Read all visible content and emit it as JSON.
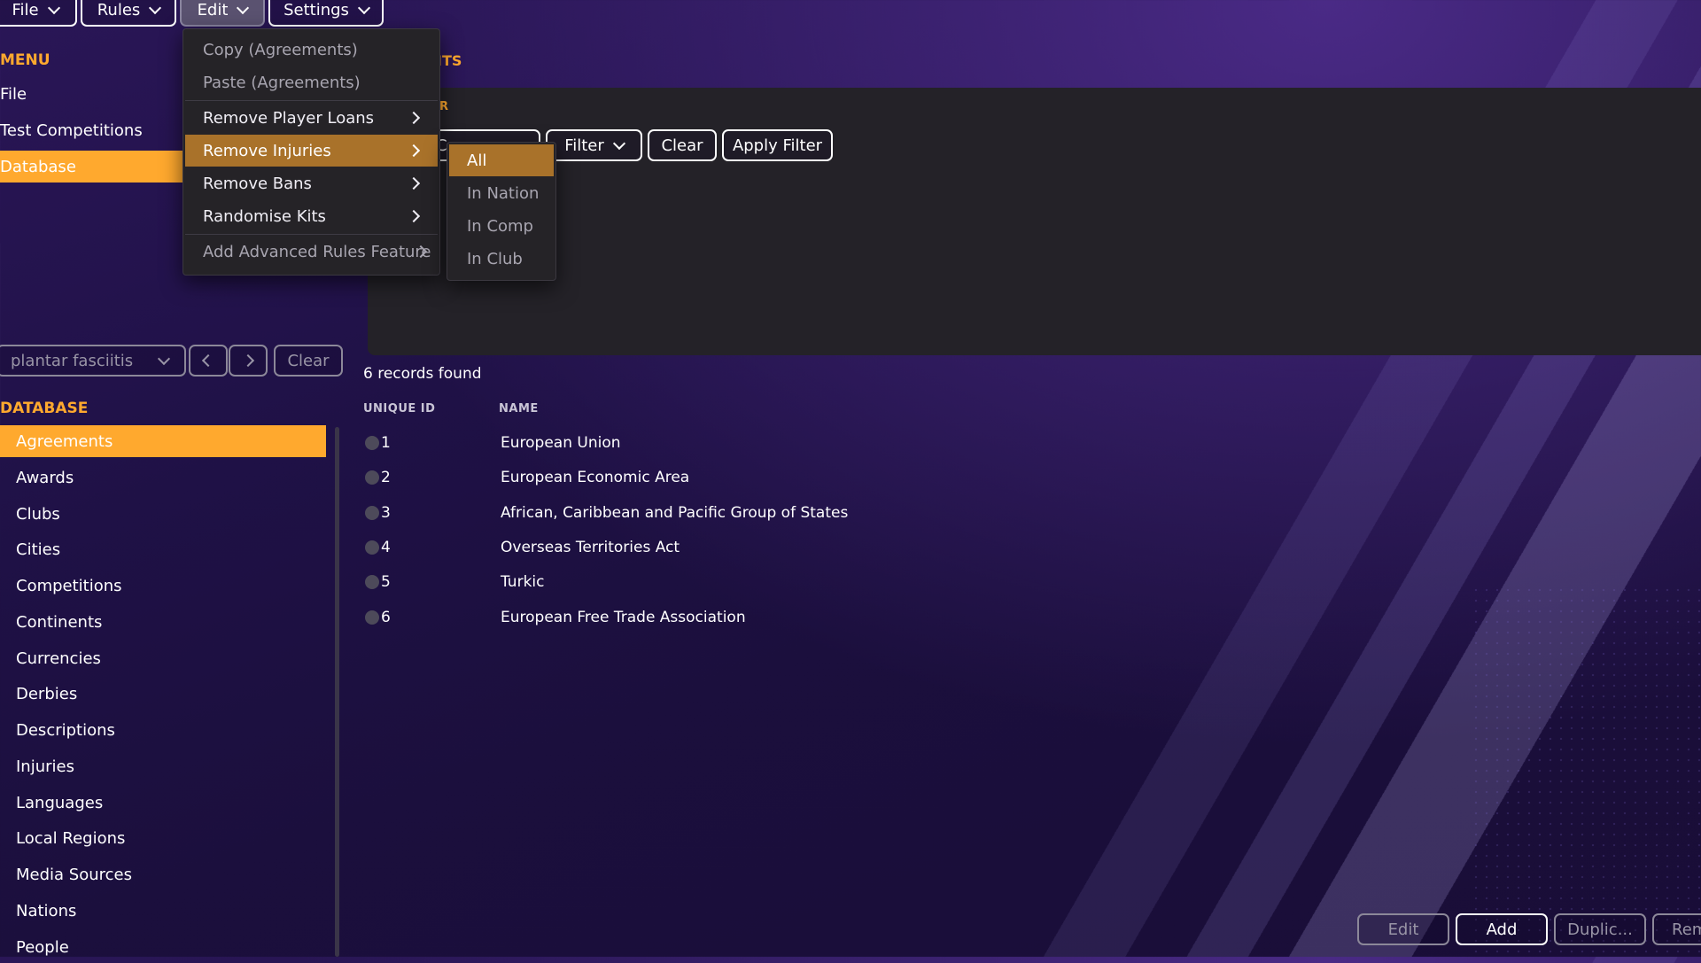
{
  "menubar": [
    {
      "label": "File"
    },
    {
      "label": "Rules"
    },
    {
      "label": "Edit"
    },
    {
      "label": "Settings"
    }
  ],
  "left_menu": {
    "title": "MENU",
    "items": [
      {
        "label": "File"
      },
      {
        "label": "Test Competitions"
      },
      {
        "label": "Database"
      }
    ]
  },
  "search": {
    "value": "plantar fasciitis",
    "clear_label": "Clear"
  },
  "database": {
    "title": "DATABASE",
    "items": [
      {
        "label": "Agreements"
      },
      {
        "label": "Awards"
      },
      {
        "label": "Clubs"
      },
      {
        "label": "Cities"
      },
      {
        "label": "Competitions"
      },
      {
        "label": "Continents"
      },
      {
        "label": "Currencies"
      },
      {
        "label": "Derbies"
      },
      {
        "label": "Descriptions"
      },
      {
        "label": "Injuries"
      },
      {
        "label": "Languages"
      },
      {
        "label": "Local Regions"
      },
      {
        "label": "Media Sources"
      },
      {
        "label": "Nations"
      },
      {
        "label": "People"
      }
    ]
  },
  "page": {
    "title_fragment": "ITS",
    "filter_fragment": "R",
    "fragment_button": "Co"
  },
  "filter_bar": {
    "filter_label": "Filter",
    "clear_label": "Clear",
    "apply_label": "Apply Filter"
  },
  "edit_menu": {
    "items": [
      {
        "label": "Copy (Agreements)"
      },
      {
        "label": "Paste (Agreements)"
      },
      {
        "label": "Remove Player Loans"
      },
      {
        "label": "Remove Injuries"
      },
      {
        "label": "Remove Bans"
      },
      {
        "label": "Randomise Kits"
      },
      {
        "label": "Add Advanced Rules Feature"
      }
    ]
  },
  "submenu": {
    "items": [
      {
        "label": "All"
      },
      {
        "label": "In Nation"
      },
      {
        "label": "In Comp"
      },
      {
        "label": "In Club"
      }
    ]
  },
  "results": {
    "count_text": "6 records found",
    "columns": [
      "UNIQUE ID",
      "NAME"
    ],
    "rows": [
      {
        "id": "1",
        "name": "European Union"
      },
      {
        "id": "2",
        "name": "European Economic Area"
      },
      {
        "id": "3",
        "name": "African, Caribbean and Pacific Group of States"
      },
      {
        "id": "4",
        "name": "Overseas Territories Act"
      },
      {
        "id": "5",
        "name": "Turkic"
      },
      {
        "id": "6",
        "name": "European Free Trade Association"
      }
    ]
  },
  "actions": {
    "edit": "Edit",
    "add": "Add",
    "duplicate": "Duplic...",
    "remove": "Rem"
  },
  "colors": {
    "accent": "#ffa92e",
    "menu_highlight": "#a9722a",
    "panel": "#242228"
  }
}
